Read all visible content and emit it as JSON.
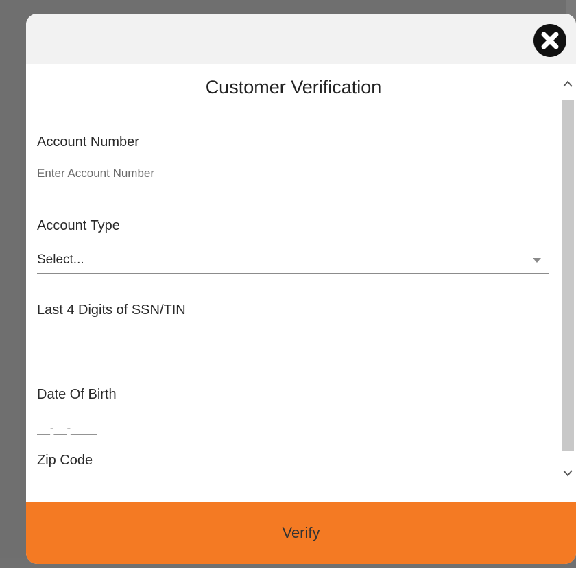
{
  "modal": {
    "title": "Customer Verification",
    "verify_label": "Verify"
  },
  "fields": {
    "account_number": {
      "label": "Account Number",
      "placeholder": "Enter Account Number",
      "value": ""
    },
    "account_type": {
      "label": "Account Type",
      "value": "Select..."
    },
    "ssn_last4": {
      "label": "Last 4 Digits of SSN/TIN",
      "value": ""
    },
    "date_of_birth": {
      "label": "Date Of Birth",
      "value": "__-__-____"
    },
    "zip_code": {
      "label": "Zip Code",
      "value": ""
    }
  },
  "colors": {
    "accent": "#f47a23",
    "header_bg": "#f2f2f2",
    "overlay": "#6f6f6f"
  },
  "icons": {
    "close": "close-circle-icon",
    "caret": "caret-down-icon",
    "scroll_up": "chevron-up-icon",
    "scroll_down": "chevron-down-icon"
  }
}
